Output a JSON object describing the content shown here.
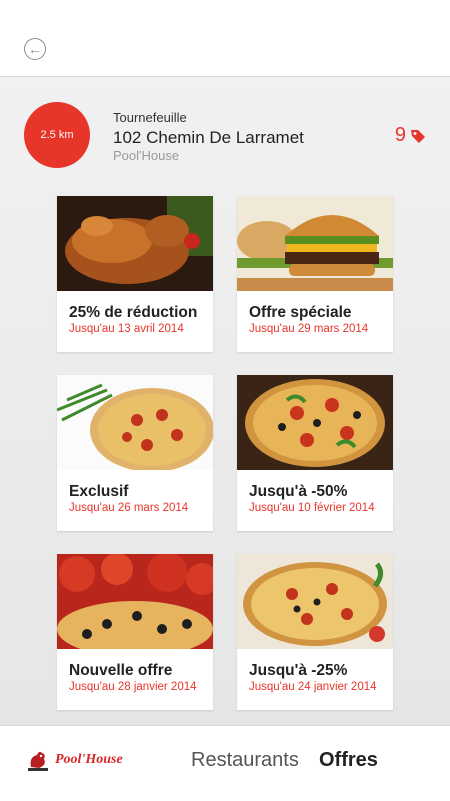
{
  "header": {
    "back_icon": "back-arrow-icon"
  },
  "restaurant": {
    "distance": "2.5 km",
    "city": "Tournefeuille",
    "street": "102 Chemin De Larramet",
    "name": "Pool'House",
    "offers_count": "9",
    "offers_icon": "tag-icon",
    "accent_color": "#e8352a"
  },
  "offers": [
    {
      "title": "25% de réduction",
      "date": "Jusqu'au 13 avril 2014",
      "image": "roast-chicken"
    },
    {
      "title": "Offre spéciale",
      "date": "Jusqu'au 29 mars 2014",
      "image": "burger"
    },
    {
      "title": "Exclusif",
      "date": "Jusqu'au 26 mars 2014",
      "image": "pizza-herbs"
    },
    {
      "title": "Jusqu'à -50%",
      "date": "Jusqu'au 10 février 2014",
      "image": "pizza-olives"
    },
    {
      "title": "Nouvelle offre",
      "date": "Jusqu'au 28 janvier 2014",
      "image": "pizza-tomatoes"
    },
    {
      "title": "Jusqu'à -25%",
      "date": "Jusqu'au 24 janvier 2014",
      "image": "pizza-vegetables"
    }
  ],
  "footer": {
    "brand": "Pool'House",
    "nav_restaurants": "Restaurants",
    "nav_offres": "Offres"
  }
}
